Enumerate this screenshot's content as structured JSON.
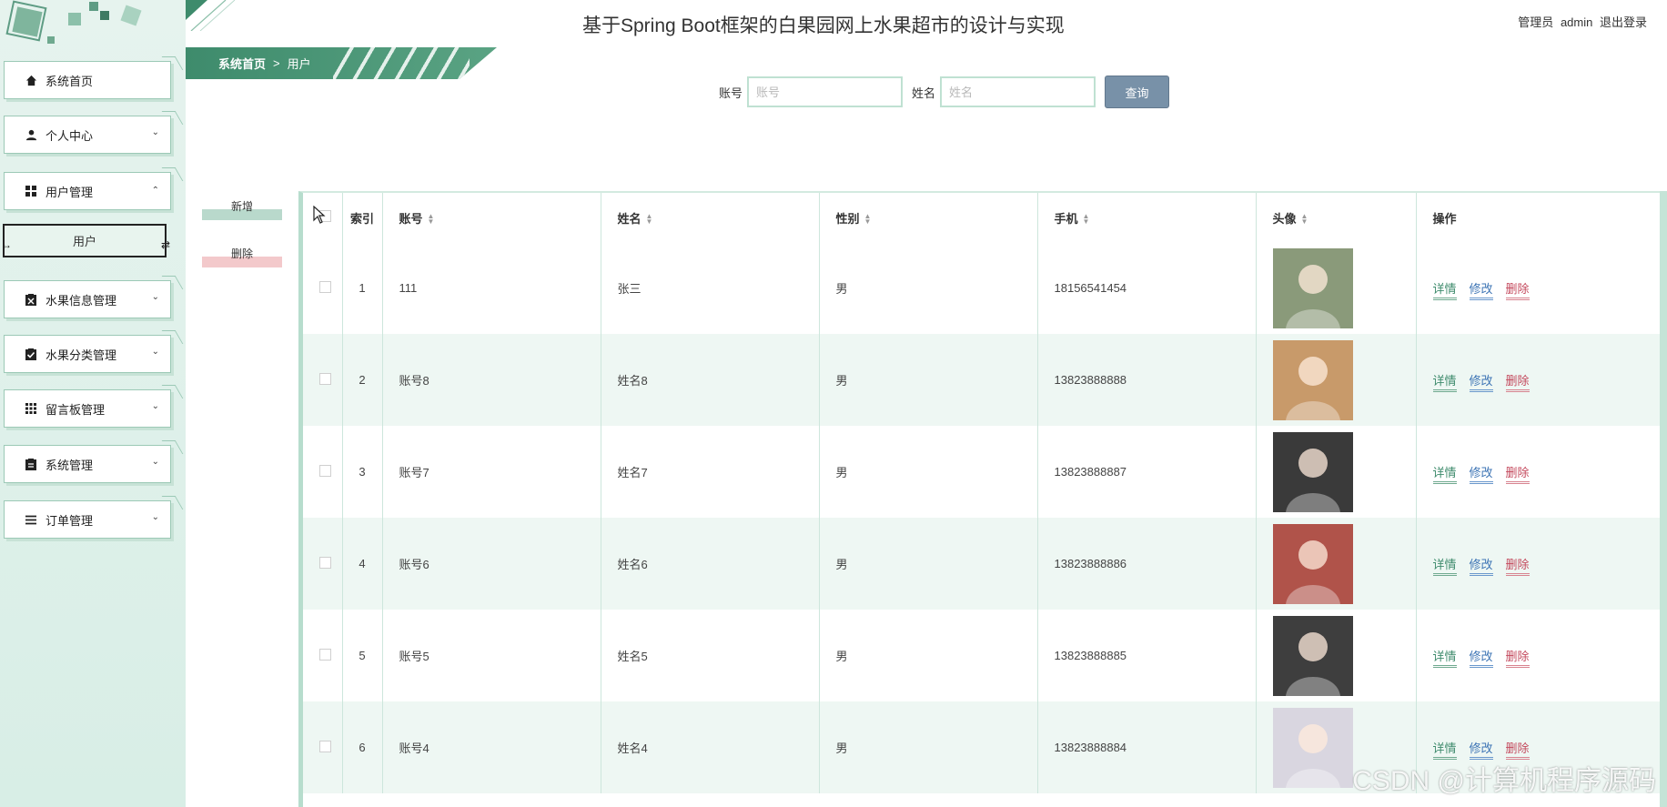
{
  "header": {
    "title": "基于Spring Boot框架的白果园网上水果超市的设计与实现",
    "role_label": "管理员",
    "username": "admin",
    "logout_label": "退出登录"
  },
  "breadcrumb": {
    "home": "系统首页",
    "separator": ">",
    "current": "用户"
  },
  "sidebar": {
    "items": [
      {
        "label": "系统首页",
        "icon": "home-icon"
      },
      {
        "label": "个人中心",
        "icon": "person-icon"
      },
      {
        "label": "用户管理",
        "icon": "grid-icon"
      },
      {
        "label": "水果信息管理",
        "icon": "clipboard-x-icon"
      },
      {
        "label": "水果分类管理",
        "icon": "clipboard-check-icon"
      },
      {
        "label": "留言板管理",
        "icon": "apps-icon"
      },
      {
        "label": "系统管理",
        "icon": "clipboard-icon"
      },
      {
        "label": "订单管理",
        "icon": "list-icon"
      }
    ],
    "active_sub": "用户"
  },
  "search": {
    "account_label": "账号",
    "account_placeholder": "账号",
    "account_value": "",
    "name_label": "姓名",
    "name_placeholder": "姓名",
    "name_value": "",
    "button_label": "查询"
  },
  "actions": {
    "add_label": "新增",
    "delete_label": "删除"
  },
  "table": {
    "headers": {
      "index": "索引",
      "account": "账号",
      "name": "姓名",
      "gender": "性别",
      "phone": "手机",
      "avatar": "头像",
      "ops": "操作"
    },
    "op_labels": {
      "detail": "详情",
      "edit": "修改",
      "delete": "删除"
    },
    "rows": [
      {
        "index": "1",
        "account": "111",
        "name": "张三",
        "gender": "男",
        "phone": "18156541454",
        "avatar_color": "#8a9a7a"
      },
      {
        "index": "2",
        "account": "账号8",
        "name": "姓名8",
        "gender": "男",
        "phone": "13823888888",
        "avatar_color": "#c89a6a"
      },
      {
        "index": "3",
        "account": "账号7",
        "name": "姓名7",
        "gender": "男",
        "phone": "13823888887",
        "avatar_color": "#3a3a3a"
      },
      {
        "index": "4",
        "account": "账号6",
        "name": "姓名6",
        "gender": "男",
        "phone": "13823888886",
        "avatar_color": "#b0534a"
      },
      {
        "index": "5",
        "account": "账号5",
        "name": "姓名5",
        "gender": "男",
        "phone": "13823888885",
        "avatar_color": "#3e3e3e"
      },
      {
        "index": "6",
        "account": "账号4",
        "name": "姓名4",
        "gender": "男",
        "phone": "13823888884",
        "avatar_color": "#d9d6e0"
      }
    ]
  },
  "watermark": "CSDN @计算机程序源码"
}
